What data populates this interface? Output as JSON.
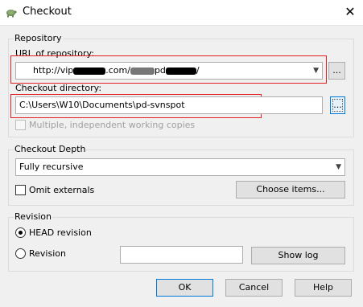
{
  "window": {
    "title": "Checkout",
    "close_glyph": "✕"
  },
  "repository": {
    "group_label": "Repository",
    "url_label": "URL of repository:",
    "url_value_visible_prefix": "http://vip",
    "url_value_visible_mid": ".com/",
    "url_value_visible_tail": "pd",
    "url_value_visible_end": "/",
    "url_browse_label": "...",
    "dir_label": "Checkout directory:",
    "dir_value": "C:\\Users\\W10\\Documents\\pd-svnspot",
    "dir_browse_label": "...",
    "multiple_wc_label": "Multiple, independent working copies"
  },
  "depth": {
    "group_label": "Checkout Depth",
    "selected": "Fully recursive",
    "omit_externals_label": "Omit externals",
    "choose_items_label": "Choose items..."
  },
  "revision": {
    "group_label": "Revision",
    "head_label": "HEAD revision",
    "revision_label": "Revision",
    "revision_value": "",
    "show_log_label": "Show log"
  },
  "buttons": {
    "ok": "OK",
    "cancel": "Cancel",
    "help": "Help"
  },
  "colors": {
    "highlight_box": "#e02020",
    "focus_border": "#0078d7"
  },
  "icons": {
    "app": "tortoise-icon",
    "close": "close-icon",
    "dropdown": "chevron-down-icon"
  }
}
